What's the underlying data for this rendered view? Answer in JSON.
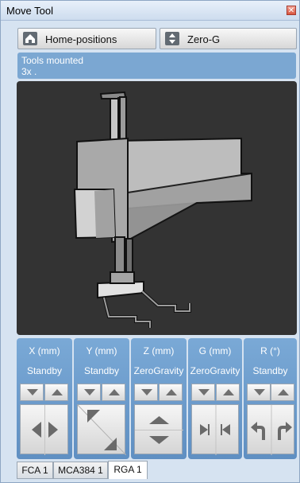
{
  "window": {
    "title": "Move Tool"
  },
  "toolbar": {
    "home_label": "Home-positions",
    "home_icon": "home-icon",
    "mode_label": "Zero-G",
    "mode_icon": "up-down-arrows-icon"
  },
  "status": {
    "line1": "Tools mounted",
    "line2": "3x ."
  },
  "axes": [
    {
      "header": "X (mm)",
      "mode": "Standby"
    },
    {
      "header": "Y (mm)",
      "mode": "Standby"
    },
    {
      "header": "Z (mm)",
      "mode": "ZeroGravity"
    },
    {
      "header": "G (mm)",
      "mode": "ZeroGravity"
    },
    {
      "header": "R (°)",
      "mode": "Standby"
    }
  ],
  "tabs": [
    {
      "label": "FCA 1",
      "active": false
    },
    {
      "label": "MCA384 1",
      "active": false
    },
    {
      "label": "RGA 1",
      "active": true
    }
  ],
  "colors": {
    "panel": "#6f9ccd",
    "viewport": "#333333",
    "status": "#7ba7d2"
  }
}
